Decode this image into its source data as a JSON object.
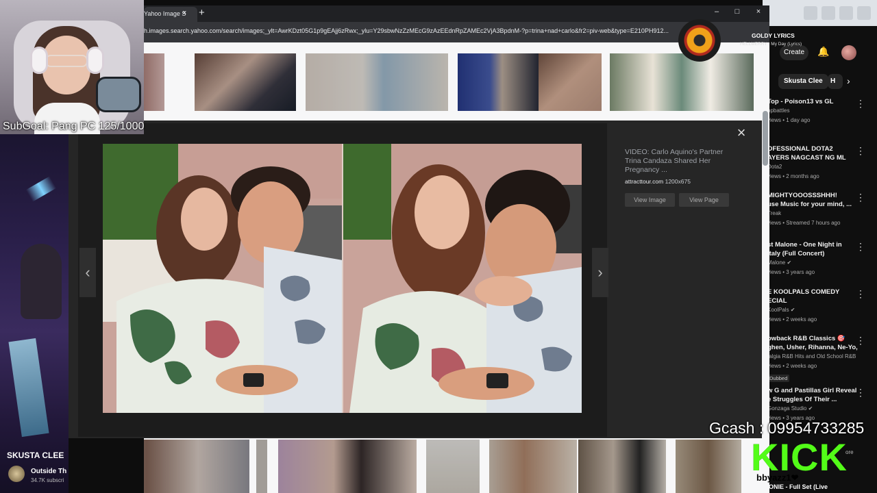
{
  "browser": {
    "tab_title": "Yahoo Image S",
    "tab_close": "×",
    "new_tab": "+",
    "minimize": "–",
    "maximize": "□",
    "close": "×",
    "url": "h.images.search.yahoo.com/search/images;_ylt=AwrKDzt05G1p9gEAjj6zRwx;_ylu=Y29sbwNzZzMEcG9zAzEEdnRpZAMEc2VjA3BpdnM-?p=trina+nad+carlo&fr2=piv-web&type=E210PH912..."
  },
  "preview": {
    "close": "×",
    "prev": "‹",
    "next": "›",
    "title": "VIDEO: Carlo Aquino's Partner Trina Candaza Shared Her Pregnancy ...",
    "source_domain": "attracttour.com",
    "dimensions": "1200x675",
    "view_image": "View Image",
    "view_page": "View Page"
  },
  "stream": {
    "subgoal": "SubGoal: Pang PC 125/1000",
    "gcash": "Gcash : 09954733285",
    "kick_logo": "KICK",
    "kick_user": "bbyazz1❤",
    "bottom_text": "ONIE - Full Set (Live",
    "bottom_more": "ore"
  },
  "now_playing": {
    "title": "GOLDY LYRICS",
    "subtitle": "HELLMERRY - My Day (Lyrics)"
  },
  "youtube": {
    "create": "Create",
    "chips": [
      "Skusta Clee",
      "H"
    ],
    "chip_next": "›",
    "items": [
      {
        "title": "Top - Poison13 vs GL",
        "meta1": "opbattles",
        "meta2": "views • 1 day ago",
        "badge": ""
      },
      {
        "title": "OFESSIONAL DOTA2",
        "title2": "AYERS NAGCAST NG ML",
        "meta1": "Dota2",
        "meta2": "views • 2 months ago",
        "badge": ""
      },
      {
        "title": "MIGHTYOOOSSSHHH!",
        "title2": "use Music for your mind, ...",
        "meta1": "Treak",
        "meta2": "views • Streamed 7 hours ago",
        "badge": ""
      },
      {
        "title": "st Malone - One Night in",
        "title2": "Italy (Full Concert)",
        "meta1": "Malone ✔",
        "meta2": "views • 3 years ago",
        "badge": ""
      },
      {
        "title": "E KOOLPALS COMEDY",
        "title2": "ECIAL",
        "meta1": "KoolPals ✔",
        "meta2": "views • 2 weeks ago",
        "badge": ""
      },
      {
        "title": "owback R&B Classics 🎯",
        "title2": "ghen, Usher, Rihanna, Ne-Yo, ...",
        "meta1": "talgia R&B Hits and Old School R&B",
        "meta2": "views • 2 weeks ago",
        "badge": "Dubbed"
      },
      {
        "title": "w G and Pastillas Girl Reveal",
        "title2": "e Struggles Of Their ...",
        "meta1": "Gonzaga Studio ✔",
        "meta2": "views • 3 years ago",
        "badge": ""
      }
    ]
  },
  "left_video": {
    "title": "SKUSTA CLEE",
    "channel": "Outside Th",
    "subs": "34.7K subscri"
  },
  "colors": {
    "kick_green": "#53fc18",
    "overlay_bg": "#262626",
    "browser_chrome": "#202124"
  }
}
